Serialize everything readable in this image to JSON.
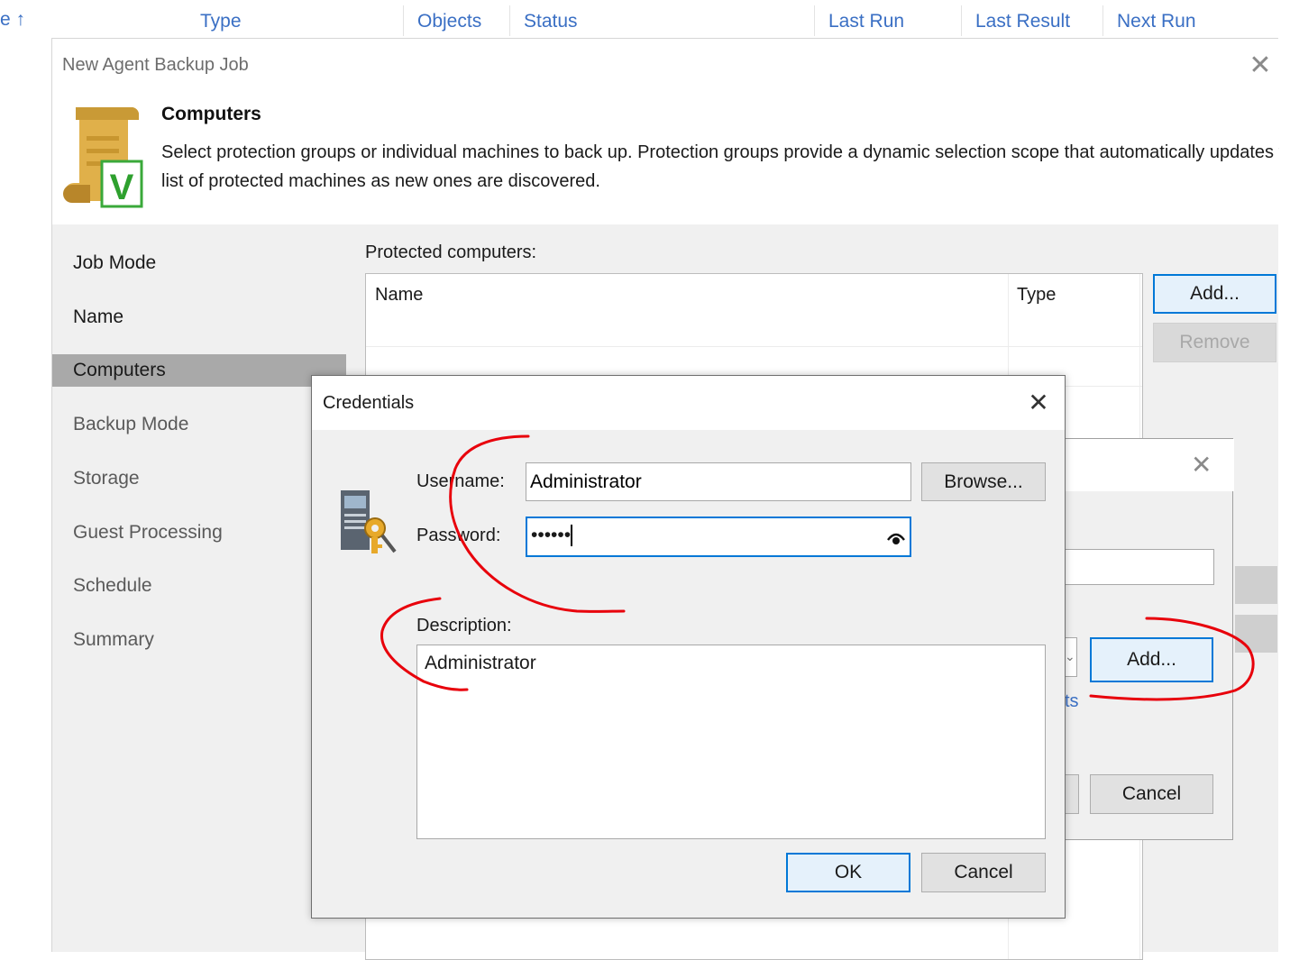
{
  "grid_header": {
    "sort_glyph": "e ↑",
    "columns": [
      "Type",
      "Objects",
      "Status",
      "Last Run",
      "Last Result",
      "Next Run"
    ]
  },
  "wizard": {
    "title": "New Agent Backup Job",
    "close_glyph": "✕",
    "step_title": "Computers",
    "step_description_line1": "Select protection groups or individual machines to back up. Protection groups provide a dynamic selection scope that automatically updates the",
    "step_description_line2": "list of protected machines as new ones are discovered.",
    "nav": [
      {
        "label": "Job Mode"
      },
      {
        "label": "Name"
      },
      {
        "label": "Computers"
      },
      {
        "label": "Backup Mode"
      },
      {
        "label": "Storage"
      },
      {
        "label": "Guest Processing"
      },
      {
        "label": "Schedule"
      },
      {
        "label": "Summary"
      }
    ],
    "protected_label": "Protected computers:",
    "table_headers": {
      "name": "Name",
      "type": "Type"
    },
    "add_label": "Add...",
    "remove_label": "Remove"
  },
  "behind_dialog": {
    "close_glyph": "✕",
    "link_fragment": "ts",
    "add_label": "Add...",
    "cancel_label": "Cancel",
    "dropdown_glyph": "⌄"
  },
  "credentials": {
    "title": "Credentials",
    "close_glyph": "✕",
    "username_label": "Username:",
    "username_value": "Administrator",
    "browse_label": "Browse...",
    "password_label": "Password:",
    "password_value": "••••••",
    "description_label": "Description:",
    "description_value": "Administrator",
    "ok_label": "OK",
    "cancel_label": "Cancel"
  },
  "colors": {
    "link_blue": "#3a6fc4",
    "focus_blue": "#0078d7",
    "annotation_red": "#e8000b",
    "nav_active": "#a9a9a9"
  }
}
